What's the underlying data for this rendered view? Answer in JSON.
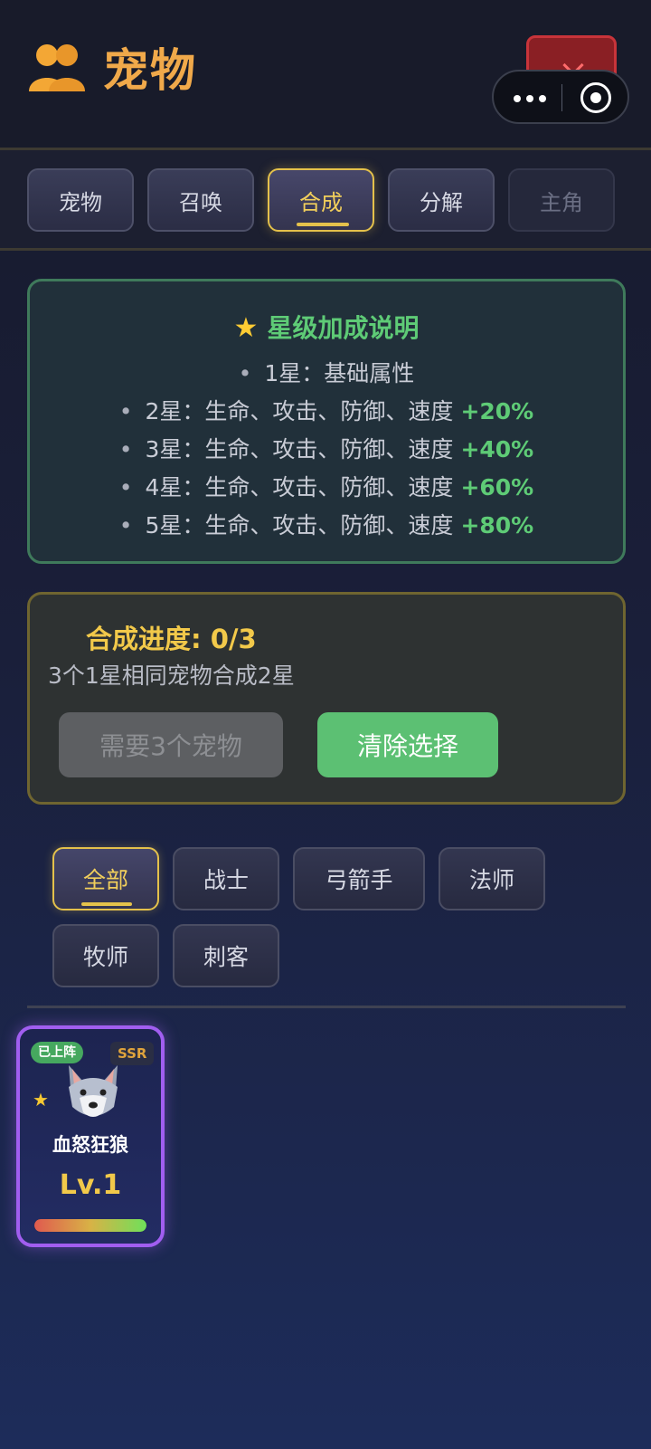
{
  "header": {
    "title": "宠物",
    "icon": "people-icon",
    "close_icon": "close-icon",
    "capsule": {
      "more_icon": "more-dots-icon",
      "target_icon": "target-icon"
    }
  },
  "tabs": [
    {
      "label": "宠物",
      "state": "normal"
    },
    {
      "label": "召唤",
      "state": "normal"
    },
    {
      "label": "合成",
      "state": "active"
    },
    {
      "label": "分解",
      "state": "normal"
    },
    {
      "label": "主角",
      "state": "disabled"
    }
  ],
  "star_info": {
    "title": "星级加成说明",
    "icon": "star-icon",
    "lines": [
      {
        "text": "1星：基础属性",
        "bonus": ""
      },
      {
        "text": "2星：生命、攻击、防御、速度",
        "bonus": "+20%"
      },
      {
        "text": "3星：生命、攻击、防御、速度",
        "bonus": "+40%"
      },
      {
        "text": "4星：生命、攻击、防御、速度",
        "bonus": "+60%"
      },
      {
        "text": "5星：生命、攻击、防御、速度",
        "bonus": "+80%"
      }
    ]
  },
  "synthesis": {
    "progress_label": "合成进度: 0/3",
    "progress_current": 0,
    "progress_total": 3,
    "description": "3个1星相同宠物合成2星",
    "need_button": "需要3个宠物",
    "clear_button": "清除选择"
  },
  "filters": [
    {
      "label": "全部",
      "active": true
    },
    {
      "label": "战士",
      "active": false
    },
    {
      "label": "弓箭手",
      "active": false
    },
    {
      "label": "法师",
      "active": false
    },
    {
      "label": "牧师",
      "active": false
    },
    {
      "label": "刺客",
      "active": false
    }
  ],
  "pets": [
    {
      "name": "血怒狂狼",
      "level": "Lv.1",
      "badge": "已上阵",
      "rarity": "SSR",
      "stars": 1,
      "icon": "wolf-icon",
      "hp_fraction": 1.0
    }
  ],
  "colors": {
    "title": "#f0a94a",
    "accent_gold": "#e4c14b",
    "green": "#5ecb76",
    "card_border": "#a15ef0"
  }
}
